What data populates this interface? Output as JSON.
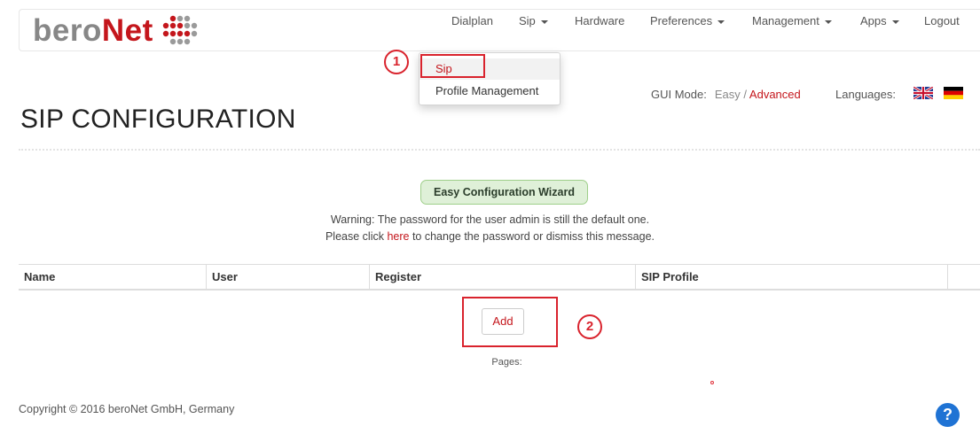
{
  "header": {
    "logo": {
      "text_part1": "bero",
      "text_part2": "Net"
    },
    "nav": [
      {
        "label": "Dialplan",
        "dropdown": false
      },
      {
        "label": "Sip",
        "dropdown": true
      },
      {
        "label": "Hardware",
        "dropdown": false
      },
      {
        "label": "Preferences",
        "dropdown": true
      },
      {
        "label": "Management",
        "dropdown": true
      },
      {
        "label": "Apps",
        "dropdown": true
      },
      {
        "label": "Logout",
        "dropdown": false
      }
    ],
    "sip_dropdown": {
      "items": [
        {
          "label": "Sip",
          "active": true
        },
        {
          "label": "Profile Management",
          "active": false
        }
      ]
    }
  },
  "annotations": {
    "marker1": "1",
    "marker2": "2"
  },
  "gui_mode": {
    "label": "GUI Mode:",
    "easy": "Easy",
    "separator": "/",
    "advanced": "Advanced"
  },
  "languages": {
    "label": "Languages:",
    "flags": [
      "uk-flag-icon",
      "germany-flag-icon"
    ]
  },
  "page": {
    "title": "SIP CONFIGURATION"
  },
  "wizard": {
    "label": "Easy Configuration Wizard"
  },
  "warning": {
    "line1": "Warning: The password for the user admin is still the default one.",
    "line2_before": "Please click ",
    "line2_link": "here",
    "line2_after": " to change the password or dismiss this message."
  },
  "table": {
    "columns": [
      "Name",
      "User",
      "Register",
      "SIP Profile"
    ]
  },
  "actions": {
    "add_label": "Add"
  },
  "pagination": {
    "label": "Pages:"
  },
  "footer": {
    "copyright": "Copyright © 2016 beroNet GmbH, Germany"
  },
  "help": {
    "label": "?"
  },
  "colors": {
    "brand_red": "#c4161c",
    "brand_gray": "#878787",
    "wizard_green": "#dff0d8",
    "help_blue": "#1f73d4",
    "annotation_red": "#d9232d"
  }
}
